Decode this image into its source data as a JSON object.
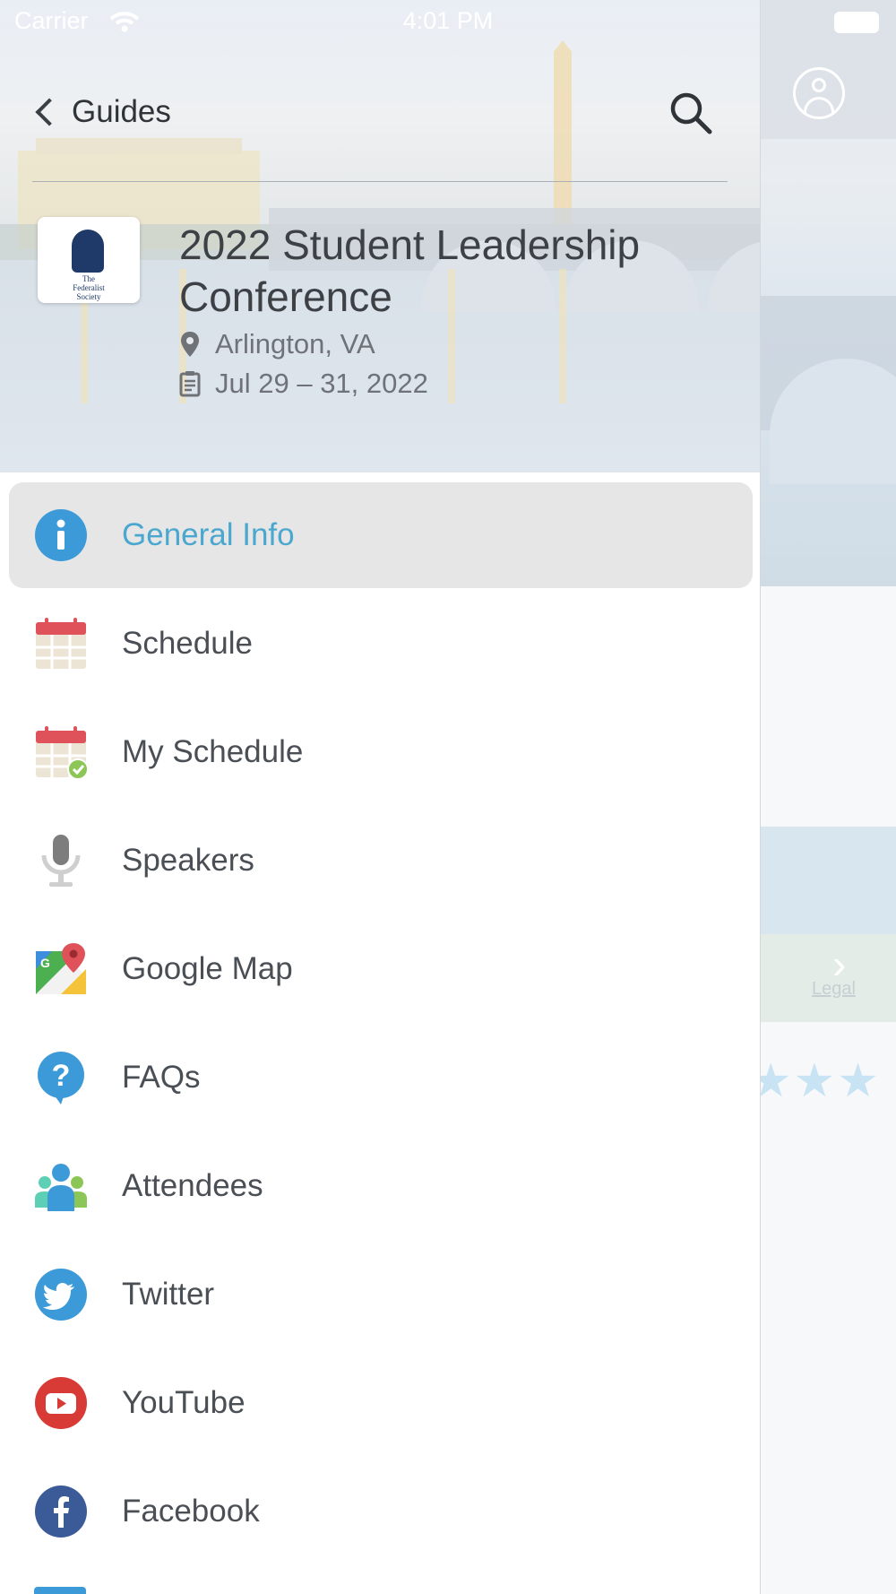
{
  "status_bar": {
    "carrier": "Carrier",
    "time": "4:01 PM"
  },
  "header": {
    "back_label": "Guides"
  },
  "event": {
    "title": "2022 Student Leadership Conference",
    "location": "Arlington, VA",
    "dates": "Jul 29 – 31, 2022",
    "logo_text": "The\nFederalist\nSociety"
  },
  "menu": [
    {
      "label": "General Info",
      "icon": "info-icon",
      "active": true
    },
    {
      "label": "Schedule",
      "icon": "calendar-icon"
    },
    {
      "label": "My Schedule",
      "icon": "calendar-check-icon"
    },
    {
      "label": "Speakers",
      "icon": "microphone-icon"
    },
    {
      "label": "Google Map",
      "icon": "google-maps-icon"
    },
    {
      "label": "FAQs",
      "icon": "question-bubble-icon"
    },
    {
      "label": "Attendees",
      "icon": "people-icon"
    },
    {
      "label": "Twitter",
      "icon": "twitter-icon"
    },
    {
      "label": "YouTube",
      "icon": "youtube-icon"
    },
    {
      "label": "Facebook",
      "icon": "facebook-icon"
    }
  ],
  "background": {
    "map_legal": "Legal"
  },
  "colors": {
    "active_label": "#4aa7cf",
    "active_bg": "#e6e6e6",
    "text": "#4a4f55"
  }
}
